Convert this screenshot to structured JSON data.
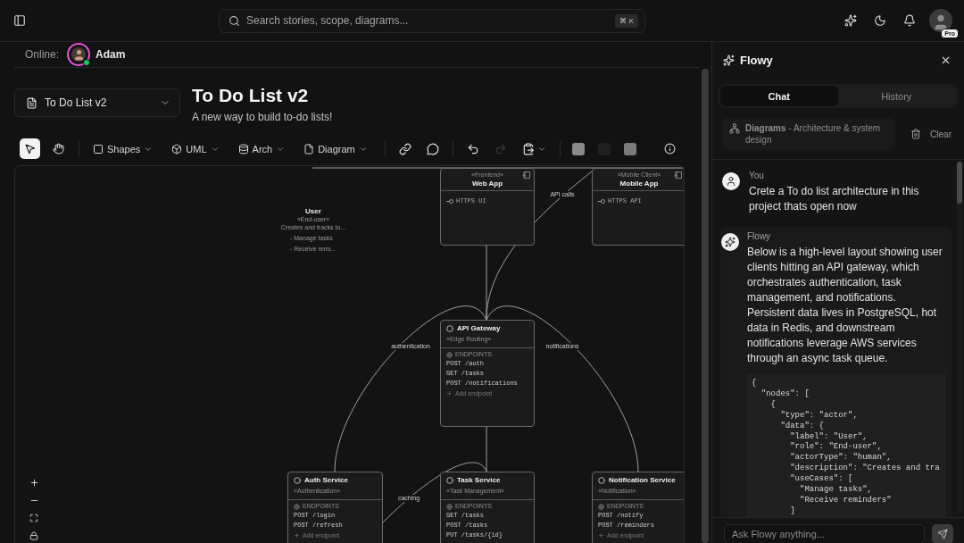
{
  "topbar": {
    "search": {
      "placeholder": "Search stories, scope, diagrams...",
      "shortcut": "⌘ K"
    },
    "account": {
      "badge": "Pro"
    }
  },
  "presence": {
    "label": "Online:",
    "users": [
      {
        "name": "Adam",
        "color": "#e052d6",
        "online": true
      }
    ]
  },
  "document": {
    "selector": "To Do List v2",
    "title": "To Do List v2",
    "subtitle": "A new way to build to-do lists!"
  },
  "toolbar": {
    "tools": [
      {
        "selected": true
      },
      {
        "selected": false
      }
    ],
    "menus": [
      {
        "label": "Shapes"
      },
      {
        "label": "UML"
      },
      {
        "label": "Arch"
      },
      {
        "label": "Diagram"
      }
    ],
    "actions": [
      {
        "disabled": false
      },
      {
        "disabled": false
      },
      {
        "disabled": false
      },
      {
        "disabled": true
      },
      {
        "disabled": false
      }
    ],
    "swatches": [
      {
        "color": "#8a8a8a"
      },
      {
        "color": "#202020"
      },
      {
        "color": "#7a7a7a"
      }
    ]
  },
  "canvas": {
    "nodes": [
      {
        "kind": "actor",
        "title": "User",
        "stereotype": "«End-user»",
        "description": "Creates and tracks to...",
        "items": [
          "- Manage tasks",
          "- Receive remi..."
        ]
      },
      {
        "kind": "client",
        "stereotype": "«Frontend»",
        "title": "Web App",
        "interfaces": [
          "HTTPS UI"
        ]
      },
      {
        "kind": "client",
        "stereotype": "«Mobile Client»",
        "title": "Mobile App",
        "interfaces": [
          "HTTPS API"
        ]
      },
      {
        "kind": "service",
        "title": "API Gateway",
        "stereotype": "«Edge Routing»",
        "section": "ENDPOINTS",
        "endpoints": [
          "POST /auth",
          "GET /tasks",
          "POST /notifications"
        ],
        "add_label": "Add endpoint"
      },
      {
        "kind": "service",
        "title": "Auth Service",
        "stereotype": "«Authentication»",
        "section": "ENDPOINTS",
        "endpoints": [
          "POST /login",
          "POST /refresh"
        ],
        "add_label": "Add endpoint"
      },
      {
        "kind": "service",
        "title": "Task Service",
        "stereotype": "«Task Management»",
        "section": "ENDPOINTS",
        "endpoints": [
          "GET /tasks",
          "POST /tasks",
          "PUT /tasks/{id}"
        ]
      },
      {
        "kind": "service",
        "title": "Notification Service",
        "stereotype": "«Notification»",
        "section": "ENDPOINTS",
        "endpoints": [
          "POST /notify",
          "POST /reminders"
        ],
        "add_label": "Add endpoint"
      }
    ],
    "edges": [
      {
        "label": "API calls"
      },
      {
        "label": "authentication"
      },
      {
        "label": "notifications"
      },
      {
        "label": "caching"
      }
    ]
  },
  "assistant": {
    "title": "Flowy",
    "tabs": [
      {
        "label": "Chat",
        "selected": true
      },
      {
        "label": "History",
        "selected": false
      }
    ],
    "context": "**Diagrams** - Architecture & system design",
    "clear": "Clear",
    "messages": [
      {
        "kind": "user",
        "author": "You",
        "text": "Crete a To do list architecture in this project thats open now"
      },
      {
        "kind": "assistant",
        "author": "Flowy",
        "text": "Below is a high-level layout showing user clients hitting an API gateway, which orchestrates authentication, task management, and notifications. Persistent data lives in PostgreSQL, hot data in Redis, and downstream notifications leverage AWS services through an async task queue.",
        "code": "{\n  \"nodes\": [\n    {\n      \"type\": \"actor\",\n      \"data\": {\n        \"label\": \"User\",\n        \"role\": \"End-user\",\n        \"actorType\": \"human\",\n        \"description\": \"Creates and tra\n        \"useCases\": [\n          \"Manage tasks\",\n          \"Receive reminders\"\n        ]"
      }
    ],
    "input": {
      "placeholder": "Ask Flowy anything..."
    }
  }
}
